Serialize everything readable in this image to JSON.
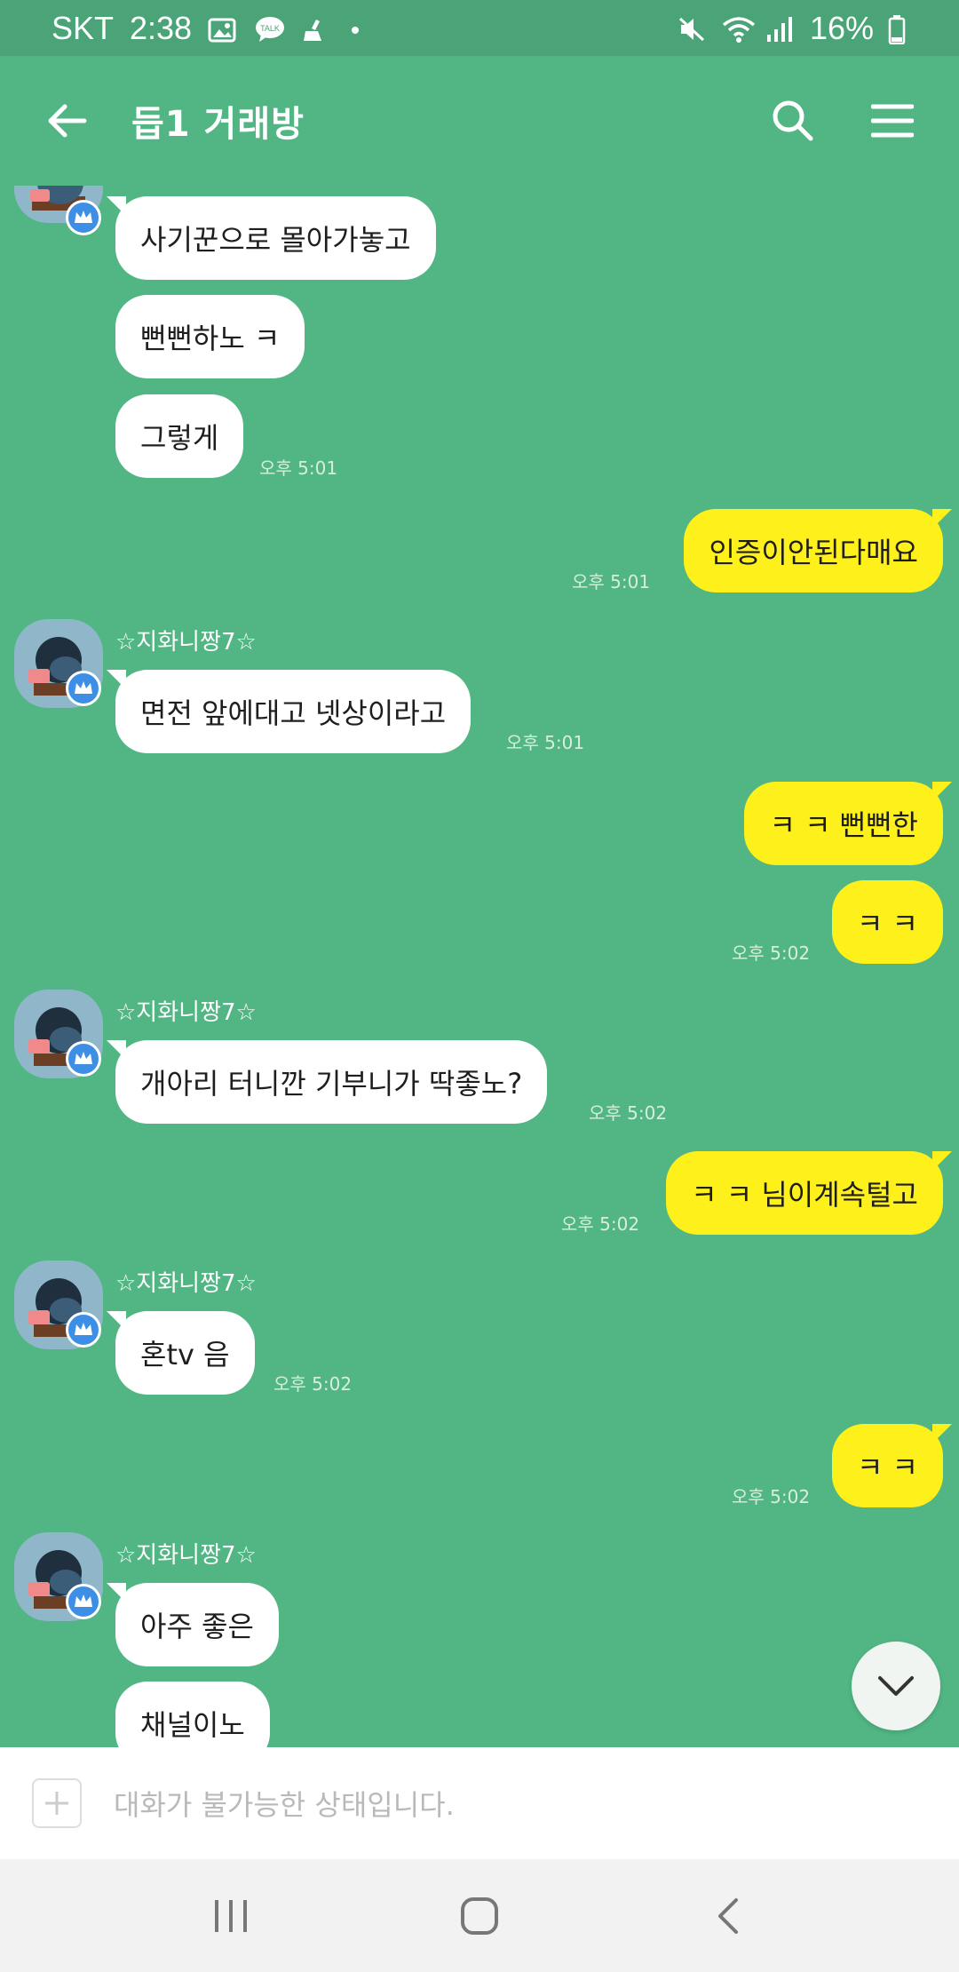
{
  "status_bar": {
    "carrier": "SKT",
    "time": "2:38",
    "battery": "16%"
  },
  "header": {
    "title": "듭1 거래방"
  },
  "messages": [
    {
      "text": "사기꾼으로 몰아가놓고"
    },
    {
      "text": "뻔뻔하노 ㅋ"
    },
    {
      "text": "그렇게",
      "time": "오후 5:01"
    },
    {
      "text": "인증이안된다매요",
      "time": "오후 5:01"
    },
    {
      "sender": "☆지화니짱7☆",
      "text": "면전 앞에대고 넷상이라고",
      "time": "오후 5:01"
    },
    {
      "text": "ㅋ ㅋ 뻔뻔한"
    },
    {
      "text": "ㅋ ㅋ",
      "time": "오후 5:02"
    },
    {
      "sender": "☆지화니짱7☆",
      "text": "개아리 터니깐 기부니가 딱좋노?",
      "time": "오후 5:02"
    },
    {
      "text": "ㅋ ㅋ 님이계속털고",
      "time": "오후 5:02"
    },
    {
      "sender": "☆지화니짱7☆",
      "text": "혼tv 음",
      "time": "오후 5:02"
    },
    {
      "text": "ㅋ ㅋ",
      "time": "오후 5:02"
    },
    {
      "sender": "☆지화니짱7☆",
      "text": "아주 좋은"
    },
    {
      "text": "채널이노"
    }
  ],
  "input": {
    "placeholder": "대화가 불가능한 상태입니다."
  },
  "colors": {
    "background": "#52b684",
    "my_bubble": "#fef01b",
    "their_bubble": "#ffffff",
    "status_bar": "#4aa478"
  }
}
